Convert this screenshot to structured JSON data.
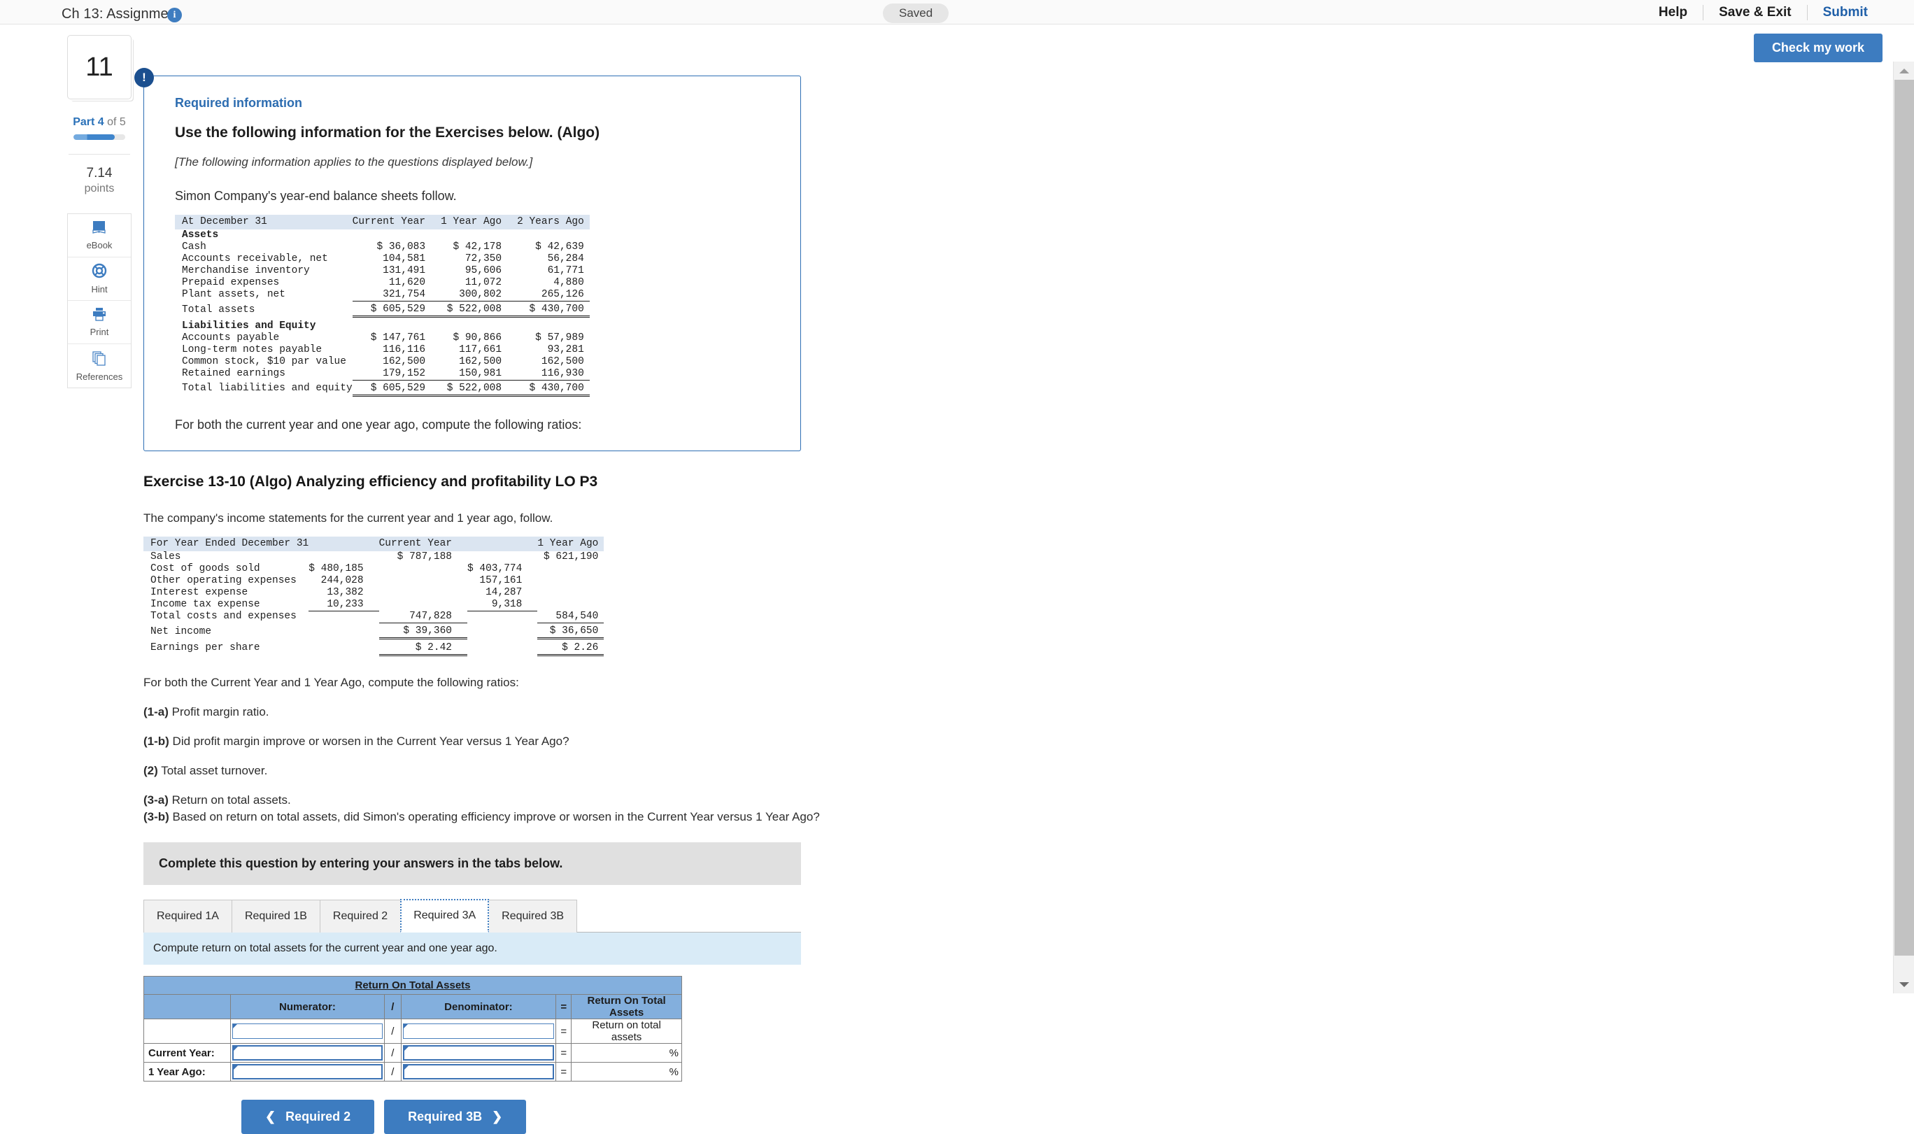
{
  "topbar": {
    "title": "Ch 13: Assignment",
    "info_icon": "info-icon",
    "saved_badge": "Saved",
    "help": "Help",
    "save_exit": "Save & Exit",
    "submit": "Submit",
    "check_my_work": "Check my work"
  },
  "rail": {
    "question_number": "11",
    "part_prefix": "Part 4",
    "part_suffix": " of 5",
    "points_value": "7.14",
    "points_label": "points",
    "tools": [
      {
        "label": "eBook",
        "icon": "ebook-icon"
      },
      {
        "label": "Hint",
        "icon": "life-ring-icon"
      },
      {
        "label": "Print",
        "icon": "printer-icon"
      },
      {
        "label": "References",
        "icon": "references-icon"
      }
    ]
  },
  "required_info": {
    "badge": "!",
    "label": "Required information",
    "heading": "Use the following information for the Exercises below. (Algo)",
    "italic_note": "[The following information applies to the questions displayed below.]",
    "intro": "Simon Company's year-end balance sheets follow.",
    "footer": "For both the current year and one year ago, compute the following ratios:"
  },
  "balance_sheet": {
    "columns": [
      "At December 31",
      "Current Year",
      "1 Year Ago",
      "2 Years Ago"
    ],
    "assets_header": "Assets",
    "assets_rows": [
      {
        "label": "Cash",
        "values": [
          "$ 36,083",
          "$ 42,178",
          "$ 42,639"
        ]
      },
      {
        "label": "Accounts receivable, net",
        "values": [
          "104,581",
          "72,350",
          "56,284"
        ]
      },
      {
        "label": "Merchandise inventory",
        "values": [
          "131,491",
          "95,606",
          "61,771"
        ]
      },
      {
        "label": "Prepaid expenses",
        "values": [
          "11,620",
          "11,072",
          "4,880"
        ]
      },
      {
        "label": "Plant assets, net",
        "values": [
          "321,754",
          "300,802",
          "265,126"
        ]
      }
    ],
    "total_assets": {
      "label": "Total assets",
      "values": [
        "$ 605,529",
        "$ 522,008",
        "$ 430,700"
      ]
    },
    "liab_header": "Liabilities and Equity",
    "liab_rows": [
      {
        "label": "Accounts payable",
        "values": [
          "$ 147,761",
          "$ 90,866",
          "$ 57,989"
        ]
      },
      {
        "label": "Long-term notes payable",
        "values": [
          "116,116",
          "117,661",
          "93,281"
        ]
      },
      {
        "label": "Common stock, $10 par value",
        "values": [
          "162,500",
          "162,500",
          "162,500"
        ]
      },
      {
        "label": "Retained earnings",
        "values": [
          "179,152",
          "150,981",
          "116,930"
        ]
      }
    ],
    "total_liab": {
      "label": "Total liabilities and equity",
      "values": [
        "$ 605,529",
        "$ 522,008",
        "$ 430,700"
      ]
    }
  },
  "exercise": {
    "title": "Exercise 13-10 (Algo) Analyzing efficiency and profitability LO P3",
    "intro": "The company's income statements for the current year and 1 year ago, follow."
  },
  "income_statement": {
    "columns": [
      "For Year Ended December 31",
      "Current Year",
      "1 Year Ago"
    ],
    "rows": [
      {
        "label": "Sales",
        "cy_sub": "",
        "cy_tot": "$ 787,188",
        "py_sub": "",
        "py_tot": "$ 621,190"
      },
      {
        "label": "Cost of goods sold",
        "cy_sub": "$ 480,185",
        "cy_tot": "",
        "py_sub": "$ 403,774",
        "py_tot": ""
      },
      {
        "label": "Other operating expenses",
        "cy_sub": "244,028",
        "cy_tot": "",
        "py_sub": "157,161",
        "py_tot": ""
      },
      {
        "label": "Interest expense",
        "cy_sub": "13,382",
        "cy_tot": "",
        "py_sub": "14,287",
        "py_tot": ""
      },
      {
        "label": "Income tax expense",
        "cy_sub": "10,233",
        "cy_tot": "",
        "py_sub": "9,318",
        "py_tot": ""
      },
      {
        "label": "Total costs and expenses",
        "cy_sub": "",
        "cy_tot": "747,828",
        "py_sub": "",
        "py_tot": "584,540"
      },
      {
        "label": "Net income",
        "cy_sub": "",
        "cy_tot": "$ 39,360",
        "py_sub": "",
        "py_tot": "$ 36,650"
      },
      {
        "label": "Earnings per share",
        "cy_sub": "",
        "cy_tot": "$ 2.42",
        "py_sub": "",
        "py_tot": "$ 2.26"
      }
    ]
  },
  "questions": {
    "lead": "For both the Current Year and 1 Year Ago, compute the following ratios:",
    "items": [
      {
        "num": "(1-a)",
        "text": " Profit margin ratio."
      },
      {
        "num": "(1-b)",
        "text": " Did profit margin improve or worsen in the Current Year versus 1 Year Ago?"
      },
      {
        "num": "(2)",
        "text": " Total asset turnover."
      },
      {
        "num": "(3-a)",
        "text": " Return on total assets."
      },
      {
        "num": "(3-b)",
        "text": " Based on return on total assets, did Simon's operating efficiency improve or worsen in the Current Year versus 1 Year Ago?"
      }
    ]
  },
  "answer_area": {
    "instruction": "Complete this question by entering your answers in the tabs below.",
    "tabs": [
      {
        "label": "Required 1A",
        "active": false
      },
      {
        "label": "Required 1B",
        "active": false
      },
      {
        "label": "Required 2",
        "active": false
      },
      {
        "label": "Required 3A",
        "active": true
      },
      {
        "label": "Required 3B",
        "active": false
      }
    ],
    "tab_instruction": "Compute return on total assets for the current year and one year ago.",
    "table": {
      "title": "Return On Total Assets",
      "headers": [
        "",
        "Numerator:",
        "/",
        "Denominator:",
        "=",
        "Return On Total Assets"
      ],
      "rows": [
        {
          "label": "",
          "numerator": "",
          "slash": "/",
          "denominator": "",
          "eq": "=",
          "result": "Return on total assets",
          "suffix": ""
        },
        {
          "label": "Current Year:",
          "numerator": "",
          "slash": "/",
          "denominator": "",
          "eq": "=",
          "result": "",
          "suffix": "%"
        },
        {
          "label": "1 Year Ago:",
          "numerator": "",
          "slash": "/",
          "denominator": "",
          "eq": "=",
          "result": "",
          "suffix": "%"
        }
      ]
    },
    "prev_button": "Required 2",
    "next_button": "Required 3B",
    "prev_icon": "chevron-left-icon",
    "next_icon": "chevron-right-icon"
  },
  "colors": {
    "accent_blue": "#3d7cc0",
    "link_blue": "#1f5fa8",
    "panel_border": "#2e6fb4",
    "table_header_blue": "#83afdd",
    "fin_header_blue": "#dbe5f1",
    "info_banner_blue": "#d9ebf7"
  }
}
